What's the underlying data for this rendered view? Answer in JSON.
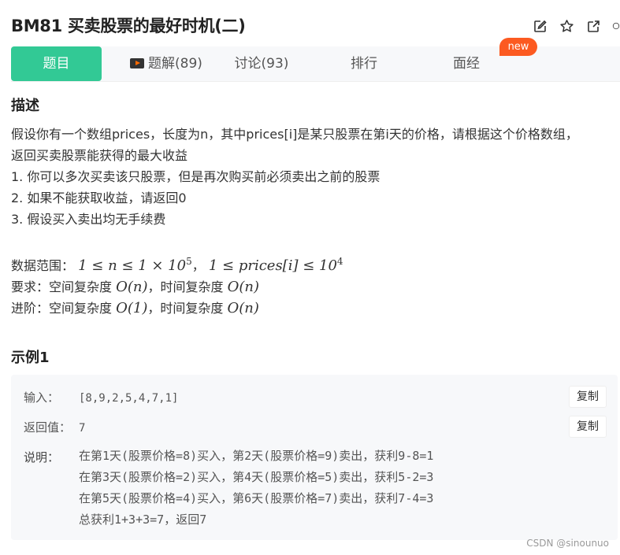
{
  "problem": {
    "title": "BM81  买卖股票的最好时机(二)"
  },
  "icons": [
    "edit-icon",
    "star-icon",
    "share-icon",
    "more-icon",
    "video-icon"
  ],
  "colors": {
    "accent": "#32c995",
    "badge": "#fc5a21",
    "panel": "#f7f8fa"
  },
  "tabs": [
    {
      "label": "题目",
      "active": true
    },
    {
      "label": "题解(89)"
    },
    {
      "label": "讨论(93)"
    },
    {
      "label": "排行"
    },
    {
      "label": "面经"
    }
  ],
  "badge": "new",
  "description": {
    "heading": "描述",
    "lines": [
      "假设你有一个数组prices，长度为n，其中prices[i]是某只股票在第i天的价格，请根据这个价格数组，",
      "返回买卖股票能获得的最大收益",
      "1. 你可以多次买卖该只股票，但是再次购买前必须卖出之前的股票",
      "2. 如果不能获取收益，请返回0",
      "3. 假设买入卖出均无手续费"
    ],
    "range_label": "数据范围：",
    "range_math_1": "1 ≤ n ≤ 1 × 10",
    "range_exp_1": "5",
    "range_sep": "，",
    "range_math_2": "1 ≤ prices[i] ≤ 10",
    "range_exp_2": "4",
    "requirement_label": "要求：空间复杂度",
    "requirement_space": "O(n)",
    "requirement_mid": "，时间复杂度",
    "requirement_time": "O(n)",
    "advanced_label": "进阶：空间复杂度",
    "advanced_space": "O(1)",
    "advanced_mid": "，时间复杂度",
    "advanced_time": "O(n)"
  },
  "example": {
    "heading": "示例1",
    "input_label": "输入：",
    "input_value": "[8,9,2,5,4,7,1]",
    "output_label": "返回值：",
    "output_value": "7",
    "explain_label": "说明：",
    "explain_lines": [
      "在第1天(股票价格=8)买入，第2天(股票价格=9)卖出，获利9-8=1",
      "在第3天(股票价格=2)买入，第4天(股票价格=5)卖出，获利5-2=3",
      "在第5天(股票价格=4)买入，第6天(股票价格=7)卖出，获利7-4=3",
      "总获利1+3+3=7，返回7"
    ],
    "copy_label": "复制"
  },
  "watermark": "CSDN @sinounuo"
}
